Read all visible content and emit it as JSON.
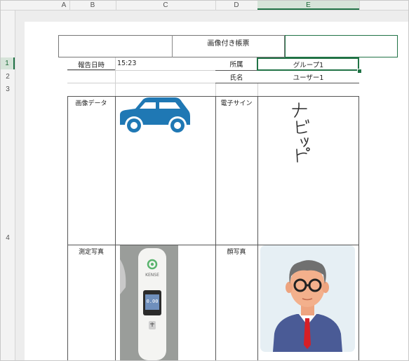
{
  "columns": [
    "A",
    "B",
    "C",
    "D",
    "E"
  ],
  "selected_column": "E",
  "rows": [
    "1",
    "2",
    "3",
    "4"
  ],
  "selected_row": "1",
  "sheet": {
    "title": "画像付き帳票",
    "report_datetime_label": "報告日時",
    "report_datetime_value": "15:23",
    "affiliation_label": "所属",
    "affiliation_value": "グループ1",
    "name_label": "氏名",
    "name_value": "ユーザー1",
    "image_data_label": "画像データ",
    "signature_label": "電子サイン",
    "signature_text": "ナビッピ",
    "measurement_photo_label": "測定写真",
    "face_photo_label": "顔写真",
    "device_brand": "KENSE",
    "device_reading": "0.00"
  },
  "colors": {
    "excel_green": "#217346",
    "car_blue": "#1f78b4",
    "suit_blue": "#4a5b96",
    "tie_red": "#d61f26"
  },
  "icons": [
    "car-icon",
    "person-avatar",
    "alcohol-checker-photo"
  ]
}
